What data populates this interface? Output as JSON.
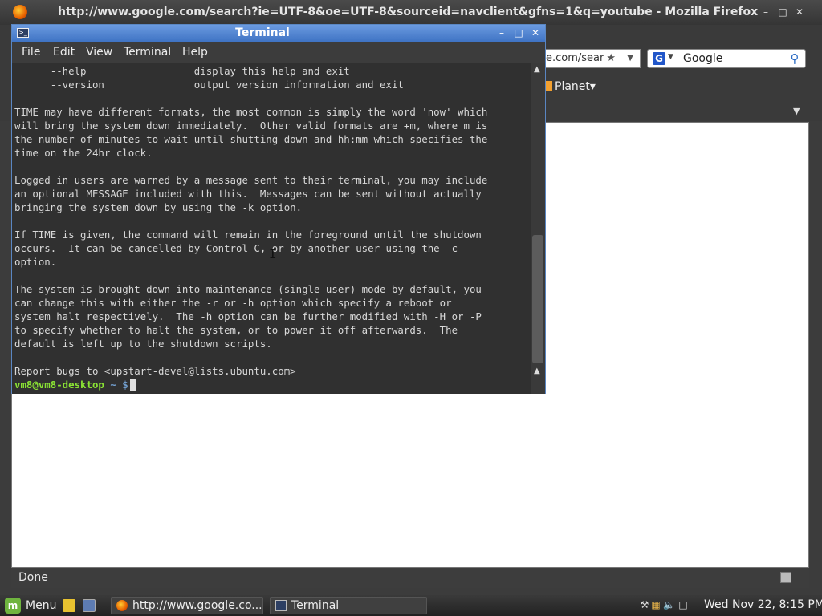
{
  "firefox": {
    "title": "http://www.google.com/search?ie=UTF-8&oe=UTF-8&sourceid=navclient&gfns=1&q=youtube - Mozilla Firefox",
    "url_visible": "e.com/sear",
    "search_engine_icon": "G",
    "search_text": "Google",
    "bookmark_label": "Planet",
    "status": "Done"
  },
  "terminal": {
    "title": "Terminal",
    "menu": [
      "File",
      "Edit",
      "View",
      "Terminal",
      "Help"
    ],
    "output_lines": [
      "      --help                  display this help and exit",
      "      --version               output version information and exit",
      "",
      "TIME may have different formats, the most common is simply the word 'now' which",
      "will bring the system down immediately.  Other valid formats are +m, where m is",
      "the number of minutes to wait until shutting down and hh:mm which specifies the",
      "time on the 24hr clock.",
      "",
      "Logged in users are warned by a message sent to their terminal, you may include",
      "an optional MESSAGE included with this.  Messages can be sent without actually",
      "bringing the system down by using the -k option.",
      "",
      "If TIME is given, the command will remain in the foreground until the shutdown",
      "occurs.  It can be cancelled by Control-C, or by another user using the -c",
      "option.",
      "",
      "The system is brought down into maintenance (single-user) mode by default, you",
      "can change this with either the -r or -h option which specify a reboot or",
      "system halt respectively.  The -h option can be further modified with -H or -P",
      "to specify whether to halt the system, or to power it off afterwards.  The",
      "default is left up to the shutdown scripts.",
      "",
      "Report bugs to <upstart-devel@lists.ubuntu.com>"
    ],
    "prompt_user": "vm8@vm8-desktop",
    "prompt_rest": " ~ $"
  },
  "taskbar": {
    "menu_label": "Menu",
    "tasks": [
      "http://www.google.co...",
      "Terminal"
    ],
    "clock": "Wed Nov 22,  8:15 PM"
  },
  "colors": {
    "terminal_title_bg": "#4f82d0",
    "prompt_green": "#8ae234",
    "prompt_blue": "#729fcf"
  }
}
